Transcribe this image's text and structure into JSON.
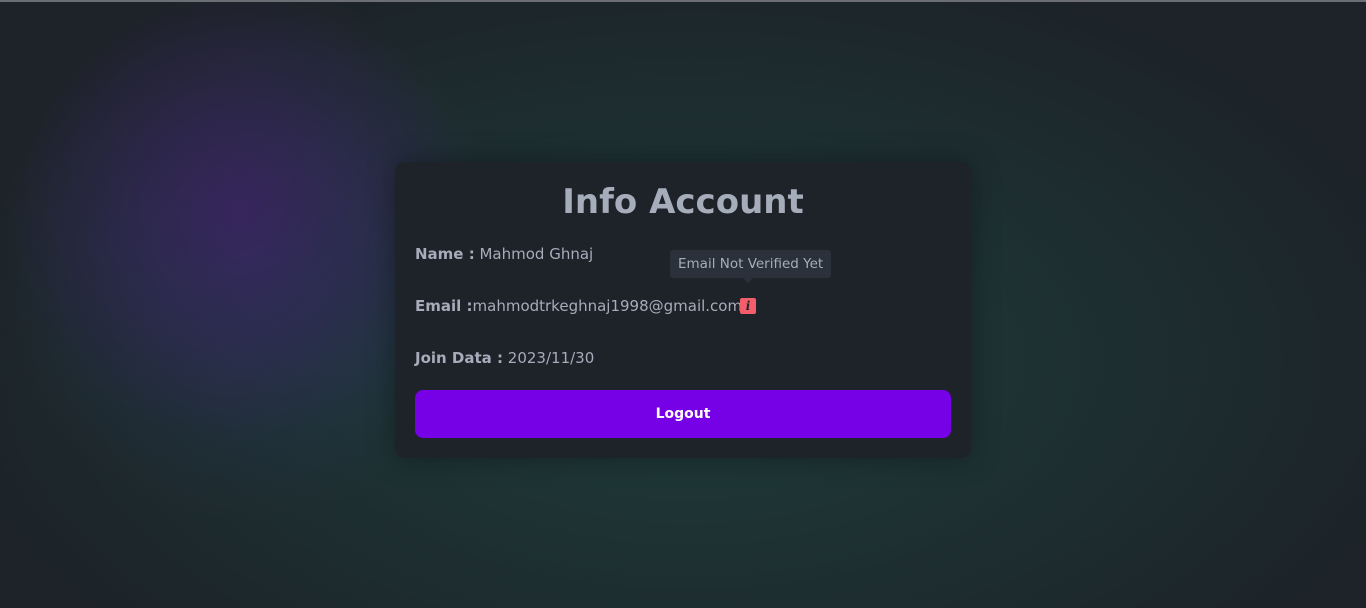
{
  "card": {
    "title": "Info Account",
    "name_label": "Name :",
    "name_value": "Mahmod Ghnaj",
    "email_label": "Email :",
    "email_value": "mahmodtrkeghnaj1998@gmail.com",
    "email_status_icon": "i",
    "email_status_tooltip": "Email Not Verified Yet",
    "join_label": "Join Data :",
    "join_value": "2023/11/30",
    "logout_label": "Logout"
  },
  "colors": {
    "accent": "#7600e6",
    "warning": "#f35e6a",
    "card_bg": "#1e2229",
    "text": "#a6adba"
  }
}
